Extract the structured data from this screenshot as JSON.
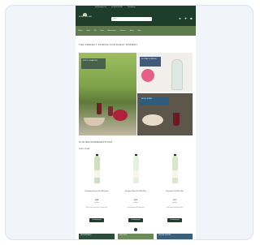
{
  "site": {
    "logo_text": "WINE CELLAR",
    "contacts": [
      "info@example.com",
      "+31 (0) 20 123 4567",
      "Free delivery"
    ],
    "search_placeholder": "Zoeken...",
    "nav": [
      "Wijnen",
      "Rood",
      "Wit",
      "Rosé",
      "Mousserend",
      "Cadeaus",
      "Acties",
      "Blog"
    ]
  },
  "page": {
    "title": "THE PERFECT PAIRING FOR EVERY MOMENT",
    "tiles": [
      {
        "badge": "SPICY & EARTHY"
      },
      {
        "badge": "FLORAL & FRESH"
      },
      {
        "badge": "BOLD & RED"
      }
    ],
    "section_title": "OUR RECOMMENDATIONS",
    "section_sub": "WHITE WINE",
    "products": [
      {
        "name": "Chardonnay Reserve 2021 White Wine",
        "price": "€14",
        "unit": "per fles",
        "note": "Fresh, citrus notes with a creamy finish",
        "button": "In winkelwagen",
        "bottle_color": "#cfe0c2"
      },
      {
        "name": "Sauvignon Blanc 2022 White Wine",
        "price": "€12",
        "unit": "per fles",
        "note": "Crisp and lively with tropical fruit",
        "button": "In winkelwagen",
        "bottle_color": "#e6f0e0"
      },
      {
        "name": "Pinot Grigio 2022 White Wine",
        "price": "€11",
        "unit": "per fles",
        "note": "Light and dry with floral aroma",
        "button": "In winkelwagen",
        "bottle_color": "#d8e6cc"
      }
    ],
    "promos": [
      {
        "text": "NEW ARRIVALS"
      },
      {
        "text": "GIFT SETS"
      },
      {
        "text": "SPECIAL OFFERS"
      }
    ]
  }
}
